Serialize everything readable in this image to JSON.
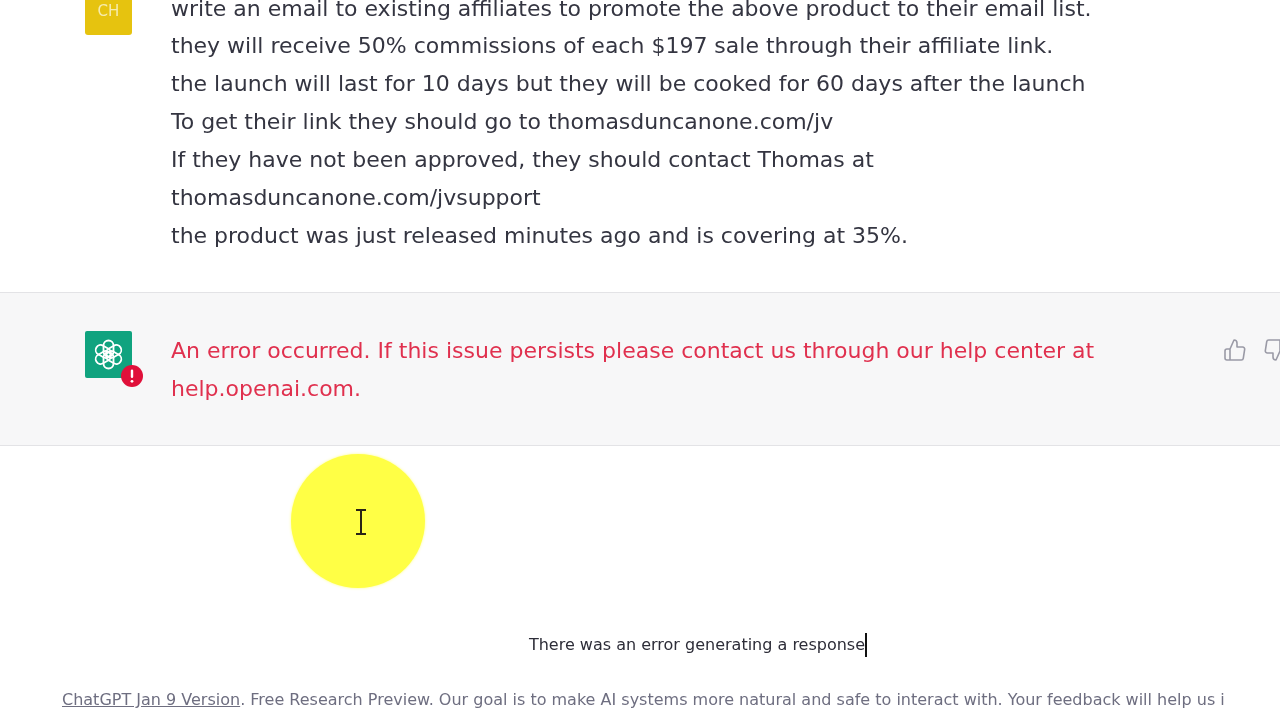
{
  "user_message": {
    "avatar": "CH",
    "lines": [
      "write an email to existing affiliates to promote the above product to their email list.",
      "they will receive 50% commissions of each $197 sale through their affiliate link.",
      "the launch will last for 10 days but they will be cooked for 60 days after the launch",
      "To get their link they should go to thomasduncanone.com/jv",
      "If they have not been approved, they should contact Thomas at thomasduncanone.com/jvsupport",
      "the product was just released minutes ago and is covering at 35%."
    ]
  },
  "assistant_message": {
    "error": true,
    "text": "An error occurred. If this issue persists please contact us through our help center at help.openai.com."
  },
  "status": {
    "text": "There was an error generating a response"
  },
  "footer": {
    "link": "ChatGPT Jan 9 Version",
    "text": ". Free Research Preview. Our goal is to make AI systems more natural and safe to interact with. Your feedback will help us i"
  }
}
